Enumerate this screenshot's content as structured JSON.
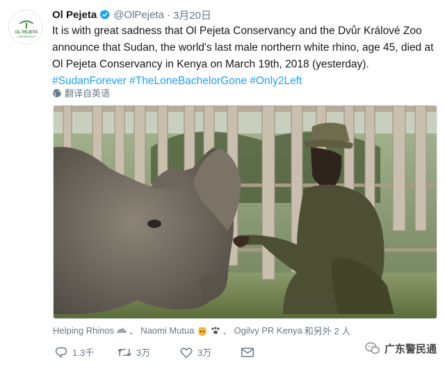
{
  "tweet": {
    "author_name": "Ol Pejeta",
    "handle": "@OlPejeta",
    "separator": "·",
    "date": "3月20日",
    "avatar_text": "OL PEJETA",
    "avatar_subtext": "CONSERVANCY",
    "text_part1": "It is with great sadness that Ol Pejeta Conservancy and the Dvůr Králové Zoo announce that Sudan, the world's last male northern white rhino, age 45, died at Ol Pejeta Conservancy in Kenya on March 19th, 2018 (yesterday).",
    "hashtags": [
      "#SudanForever",
      "#TheLoneBachelorGone",
      "#Only2Left"
    ],
    "translate_label": "翻译自英语"
  },
  "tags": {
    "tag1": "Helping Rhinos",
    "sep1": "、",
    "tag2": "Naomi Mutua",
    "sep2": "、",
    "tag3": "Ogilvy PR Kenya",
    "more": "和另外 2 人"
  },
  "actions": {
    "reply_count": "1.3千",
    "retweet_count": "3万",
    "like_count": "3万"
  },
  "watermark": {
    "label": "广东警民通"
  },
  "colors": {
    "accent": "#1da1f2",
    "secondary_text": "#657786",
    "primary_text": "#14171a",
    "avatar_green": "#3a8a3a"
  }
}
